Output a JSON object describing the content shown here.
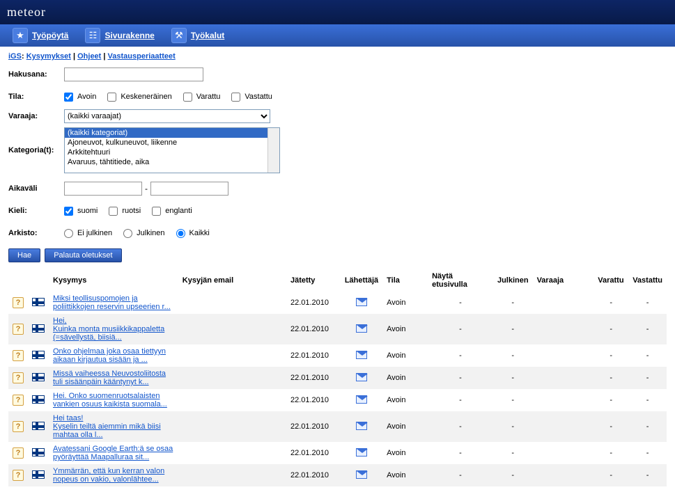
{
  "logo": "meteor",
  "nav": {
    "items": [
      {
        "label": "Työpöytä"
      },
      {
        "label": "Sivurakenne"
      },
      {
        "label": "Työkalut"
      }
    ]
  },
  "breadcrumb": {
    "a": "iGS",
    "b": "Kysymykset",
    "sep": " | ",
    "c": "Ohjeet",
    "d": "Vastausperiaatteet"
  },
  "filters": {
    "hakusana_label": "Hakusana:",
    "tila_label": "Tila:",
    "tila_opts": {
      "avoin": "Avoin",
      "kesken": "Keskeneräinen",
      "varattu": "Varattu",
      "vastattu": "Vastattu"
    },
    "varaaja_label": "Varaaja:",
    "varaaja_value": "(kaikki varaajat)",
    "kategoria_label": "Kategoria(t):",
    "kategoria_opts": [
      "(kaikki kategoriat)",
      "Ajoneuvot, kulkuneuvot, liikenne",
      "Arkkitehtuuri",
      "Avaruus, tähtitiede, aika"
    ],
    "aikavali_label": "Aikaväli",
    "aikavali_sep": "-",
    "kieli_label": "Kieli:",
    "kieli_opts": {
      "fi": "suomi",
      "sv": "ruotsi",
      "en": "englanti"
    },
    "arkisto_label": "Arkisto:",
    "arkisto_opts": {
      "ei": "Ei julkinen",
      "jul": "Julkinen",
      "kaikki": "Kaikki"
    }
  },
  "buttons": {
    "hae": "Hae",
    "palauta": "Palauta oletukset"
  },
  "table": {
    "headers": {
      "kysymys": "Kysymys",
      "email": "Kysyjän email",
      "jatetty": "Jätetty",
      "lahettaja": "Lähettäjä",
      "tila": "Tila",
      "nayta": "Näytä etusivulla",
      "julkinen": "Julkinen",
      "varaaja": "Varaaja",
      "varattu": "Varattu",
      "vastattu": "Vastattu"
    },
    "rows": [
      {
        "text": "Miksi teollisuspomojen ja poliittikkojen reservin upseerien r...",
        "jatetty": "22.01.2010",
        "tila": "Avoin"
      },
      {
        "text": "Hei,\nKuinka monta musiikkikappaletta (=sävellystä, biisiä...",
        "jatetty": "22.01.2010",
        "tila": "Avoin"
      },
      {
        "text": "Onko ohjelmaa joka osaa tiettyyn aikaan kirjautua sisään ja ...",
        "jatetty": "22.01.2010",
        "tila": "Avoin"
      },
      {
        "text": "Missä vaiheessa Neuvostoliitosta tuli sisäänpäin kääntynyt k...",
        "jatetty": "22.01.2010",
        "tila": "Avoin"
      },
      {
        "text": "Hei. Onko suomenruotsalaisten vankien osuus kaikista suomala...",
        "jatetty": "22.01.2010",
        "tila": "Avoin"
      },
      {
        "text": "Hei taas!\nKyselin teiltä aiemmin mikä biisi mahtaa olla l...",
        "jatetty": "22.01.2010",
        "tila": "Avoin"
      },
      {
        "text": "Avatessani Google Earth:ä se osaa pyöräyttää Maapalluraa sit...",
        "jatetty": "22.01.2010",
        "tila": "Avoin"
      },
      {
        "text": "Ymmärrän, että kun kerran valon nopeus on vakio, valonlähtee...",
        "jatetty": "22.01.2010",
        "tila": "Avoin"
      }
    ],
    "dash": "-"
  }
}
